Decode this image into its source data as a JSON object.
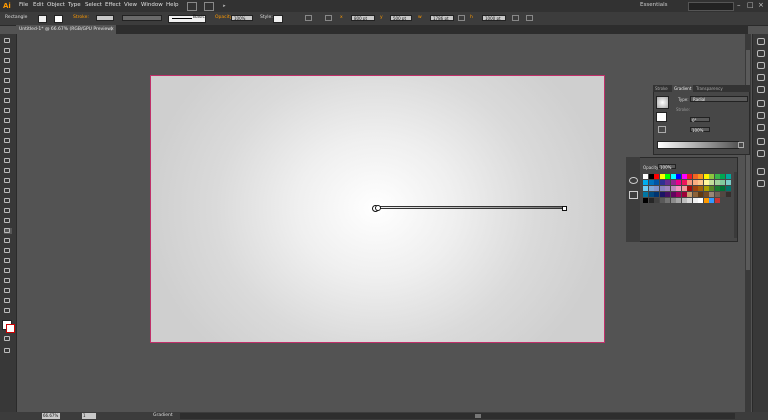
{
  "app": {
    "logo": "Ai"
  },
  "menu": {
    "items": [
      "File",
      "Edit",
      "Object",
      "Type",
      "Select",
      "Effect",
      "View",
      "Window",
      "Help"
    ]
  },
  "workspace": {
    "label": "Essentials"
  },
  "controlbar": {
    "selection_label": "Rectangle",
    "stroke_label": "Stroke:",
    "brush_label": "Basic",
    "opacity_label": "Opacity:",
    "opacity_value": "100%",
    "style_label": "Style:",
    "x_value": "800 pt",
    "y_value": "500 pt",
    "w_value": "1786 pt",
    "h_value": "1000 pt"
  },
  "document": {
    "tab_title": "Untitled-1* @ 66.67% (RGB/GPU Preview)"
  },
  "status": {
    "zoom": "66.67%",
    "page": "1",
    "tool_text": "Gradient"
  },
  "gradient_panel": {
    "tabs": [
      "Stroke",
      "Gradient",
      "Transparency"
    ],
    "type_label": "Type:",
    "type_value": "Radial",
    "stroke_label": "Stroke:",
    "angle_value": "0°",
    "aspect_value": "100%"
  },
  "swatch_panel": {
    "opacity_label": "Opacity:",
    "opacity_value": "100%",
    "colors": [
      "#ffffff",
      "#000000",
      "#ff0000",
      "#ffff00",
      "#00ff00",
      "#00ffff",
      "#0000ff",
      "#ff00ff",
      "#ed1c24",
      "#f26522",
      "#f7941d",
      "#fff200",
      "#8dc63f",
      "#39b54a",
      "#00a651",
      "#00a99d",
      "#00aeef",
      "#0072bc",
      "#0054a6",
      "#2e3192",
      "#662d91",
      "#92278f",
      "#ec008c",
      "#ed145b",
      "#f7977a",
      "#f9ad81",
      "#fdc68a",
      "#fff79a",
      "#c4df9b",
      "#a3d39c",
      "#82ca9d",
      "#7bcdc8",
      "#6ecff6",
      "#7ea7d8",
      "#8493ca",
      "#8882be",
      "#a187be",
      "#bc8dbf",
      "#f49ac2",
      "#f6989d",
      "#9e0b0f",
      "#a0410d",
      "#a3620a",
      "#aba000",
      "#598527",
      "#1a7b30",
      "#007236",
      "#00746b",
      "#0076a3",
      "#004b80",
      "#003471",
      "#1b1464",
      "#440e62",
      "#630460",
      "#9e005d",
      "#9e0039",
      "#c69c6d",
      "#8c6239",
      "#603913",
      "#754c24",
      "#998675",
      "#736357",
      "#534741",
      "#362f2d",
      "#000000",
      "#262626",
      "#404040",
      "#595959",
      "#737373",
      "#8c8c8c",
      "#a6a6a6",
      "#bfbfbf",
      "#d9d9d9",
      "#f2f2f2",
      "#ffffff",
      "#ff9900",
      "#3399ff",
      "#cc3333"
    ]
  }
}
